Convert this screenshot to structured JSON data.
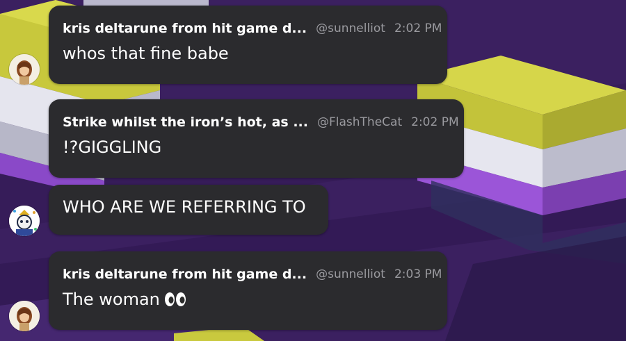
{
  "messages": [
    {
      "name": "kris deltarune from hit game d...",
      "handle": "@sunnelliot",
      "time": "2:02 PM",
      "text": "whos that fine babe",
      "avatar_icon": "kris-deltarune-avatar"
    },
    {
      "name": "Strike whilst the iron’s hot, as ...",
      "handle": "@FlashTheCat",
      "time": "2:02 PM",
      "text": "!?GIGGLING",
      "avatar_icon": null
    },
    {
      "text": "WHO ARE WE REFERRING TO",
      "avatar_icon": "party-character-avatar"
    },
    {
      "name": "kris deltarune from hit game d...",
      "handle": "@sunnelliot",
      "time": "2:03 PM",
      "text": "The woman",
      "emoji": "eyes-emoji",
      "avatar_icon": "kris-deltarune-avatar"
    }
  ],
  "colors": {
    "bubble": "#2b2b2e",
    "meta_text": "#9a9a9f",
    "background_purple": "#3a1f5c",
    "block_yellow": "#cfcf45",
    "block_white": "#e6e6f0"
  }
}
